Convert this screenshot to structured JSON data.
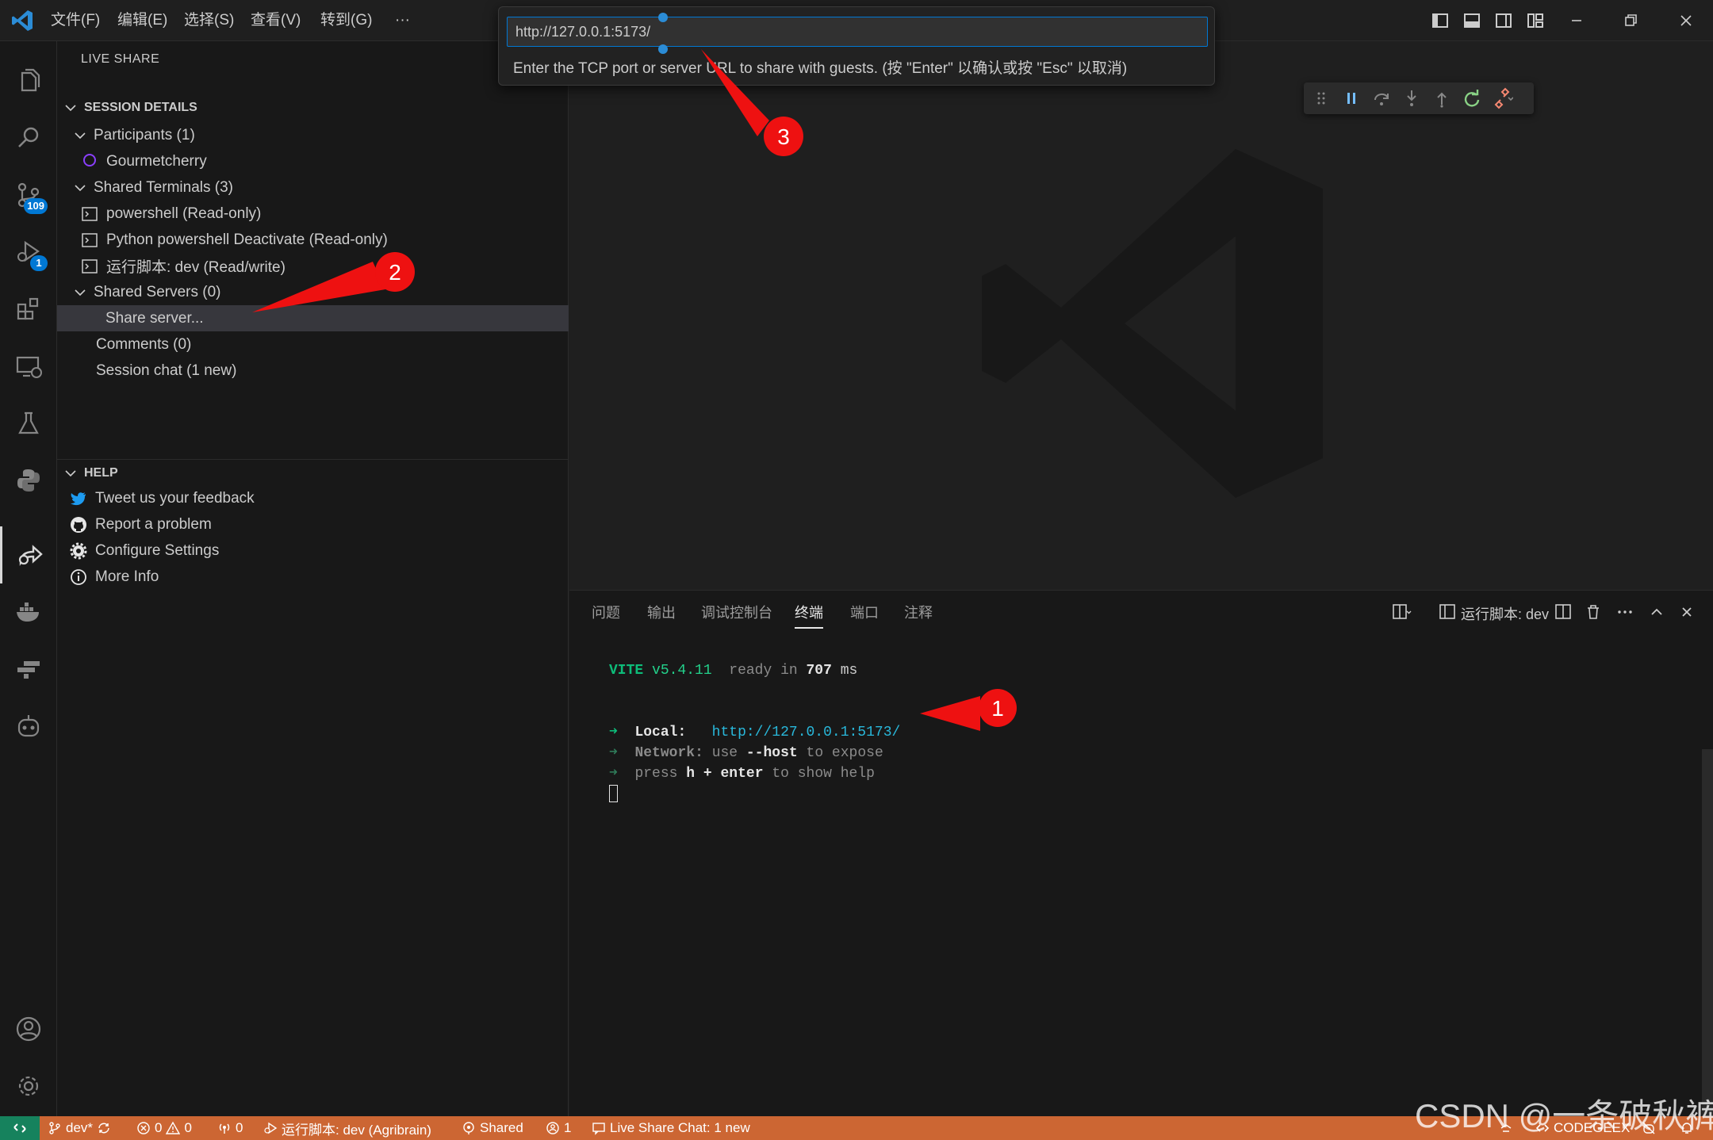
{
  "titlebar": {
    "menus": [
      "文件(F)",
      "编辑(E)",
      "选择(S)",
      "查看(V)",
      "转到(G)"
    ],
    "more": "···"
  },
  "activitybar": {
    "scm_badge": "109",
    "debug_badge": "1"
  },
  "sidebar": {
    "title": "LIVE SHARE",
    "session_section": "SESSION DETAILS",
    "participants": "Participants (1)",
    "participant_name": "Gourmetcherry",
    "shared_terminals": "Shared Terminals (3)",
    "terminals": [
      "powershell (Read-only)",
      "Python powershell Deactivate (Read-only)",
      "运行脚本: dev (Read/write)"
    ],
    "shared_servers": "Shared Servers (0)",
    "share_server": "Share server...",
    "comments": "Comments (0)",
    "session_chat": "Session chat (1 new)",
    "help_section": "HELP",
    "help_items": [
      "Tweet us your feedback",
      "Report a problem",
      "Configure Settings",
      "More Info"
    ]
  },
  "quick_input": {
    "value": "http://127.0.0.1:5173/",
    "hint": "Enter the TCP port or server URL to share with guests. (按 \"Enter\" 以确认或按 \"Esc\" 以取消)"
  },
  "panel": {
    "tabs": [
      "问题",
      "输出",
      "调试控制台",
      "终端",
      "端口",
      "注释"
    ],
    "terminal_name": "运行脚本: dev"
  },
  "terminal": {
    "vite": "VITE",
    "version": "v5.4.11",
    "ready": "ready in",
    "ms_value": "707",
    "ms_unit": "ms",
    "arrow": "➜",
    "local_label": "Local:",
    "local_url": "http://127.0.0.1:5173/",
    "network_label": "Network:",
    "network_use": "use",
    "network_flag": "--host",
    "network_rest": "to expose",
    "press": "press",
    "press_key": "h + enter",
    "press_rest": "to show help"
  },
  "statusbar": {
    "branch": "dev*",
    "errors": "0",
    "warnings": "0",
    "ports": "0",
    "run_task": "运行脚本: dev (Agribrain)",
    "shared": "Shared",
    "participants": "1",
    "chat": "Live Share Chat: 1 new",
    "codegeex": "CODEGEEX"
  },
  "annotations": {
    "marker_1": "1",
    "marker_2": "2",
    "marker_3": "3",
    "watermark": "CSDN @一条破秋裤"
  },
  "colors": {
    "accent": "#0078d4",
    "statusbar": "#cc6633",
    "remote": "#16825d",
    "annotation_red": "#ee1111"
  }
}
